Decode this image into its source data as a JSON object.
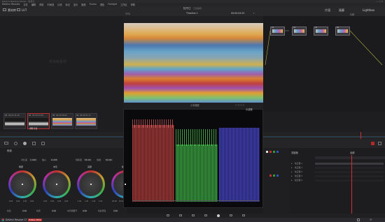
{
  "titlebar": {
    "app": "DaVinci Resolve Studio - 牡丹江"
  },
  "menu": [
    "DaVinci Resolve",
    "文件",
    "编辑",
    "修剪",
    "时间线",
    "片段",
    "标记",
    "显示",
    "播放",
    "Fusion",
    "调色",
    "Fairlight",
    "工作区",
    "帮助"
  ],
  "header": {
    "left_tabs": [
      "素材库",
      "LUT"
    ],
    "zoom": "37%",
    "project": "牡丹江",
    "edited": "已经编辑",
    "timeline": "Timeline 1",
    "timecode": "00:00:04:29",
    "right_tabs": [
      "片段",
      "画廊",
      "Lightbox"
    ],
    "node_label": "片段"
  },
  "viewer": {
    "clip_name": "小米播放",
    "mode": "示波器"
  },
  "nodes": [
    {
      "label": "01"
    },
    {
      "label": "02"
    },
    {
      "label": "03"
    },
    {
      "label": "04"
    }
  ],
  "thumbnails": [
    {
      "tc": "00:01:21:20",
      "num": "01",
      "name": "",
      "style": "bw"
    },
    {
      "tc": "00:00:24:28",
      "num": "02",
      "name": "调整 片段",
      "style": "bw"
    },
    {
      "tc": "00:00:28:00",
      "num": "03",
      "name": "",
      "style": "rainbow"
    },
    {
      "tc": "00:00:31:11",
      "num": "04",
      "name": "",
      "style": "rainbow"
    }
  ],
  "color_panel": {
    "title": "色轮",
    "params": [
      {
        "label": "对比度",
        "value": "1.000"
      },
      {
        "label": "轴心",
        "value": "0.435"
      },
      {
        "label": "饱和度",
        "value": "50.00"
      },
      {
        "label": "色相",
        "value": "50.00"
      },
      {
        "label": "亮度混合",
        "value": "100.00"
      }
    ],
    "wheels": [
      {
        "name": "暗部",
        "values": [
          "0.00",
          "0.00",
          "0.00",
          "0.00"
        ]
      },
      {
        "name": "中灰",
        "values": [
          "0.00",
          "0.00",
          "0.00",
          "0.00"
        ]
      },
      {
        "name": "亮部",
        "values": [
          "1.00",
          "1.00",
          "1.00",
          "1.00"
        ]
      },
      {
        "name": "偏移",
        "values": [
          "25.00",
          "25.00",
          "25.00",
          "25.00"
        ]
      }
    ],
    "bottom": [
      {
        "label": "色温",
        "value": "0.00"
      },
      {
        "label": "色调",
        "value": "0.00"
      },
      {
        "label": "中间调细节",
        "value": "0.00"
      },
      {
        "label": "色彩增强",
        "value": "0.00"
      },
      {
        "label": "阴影",
        "value": "0.00"
      },
      {
        "label": "高光",
        "value": "0.00"
      },
      {
        "label": "亮度混合",
        "value": "100.00"
      }
    ]
  },
  "keyframes": {
    "title": "关键帧",
    "mode": "全部",
    "tracks": [
      "校正器 1",
      "校正器 1",
      "校正器 2",
      "校正器 3",
      "校正器 4"
    ]
  },
  "taskbar": {
    "app": "DaVinci Resolve 17",
    "badge": "PUBLIC BETA"
  }
}
